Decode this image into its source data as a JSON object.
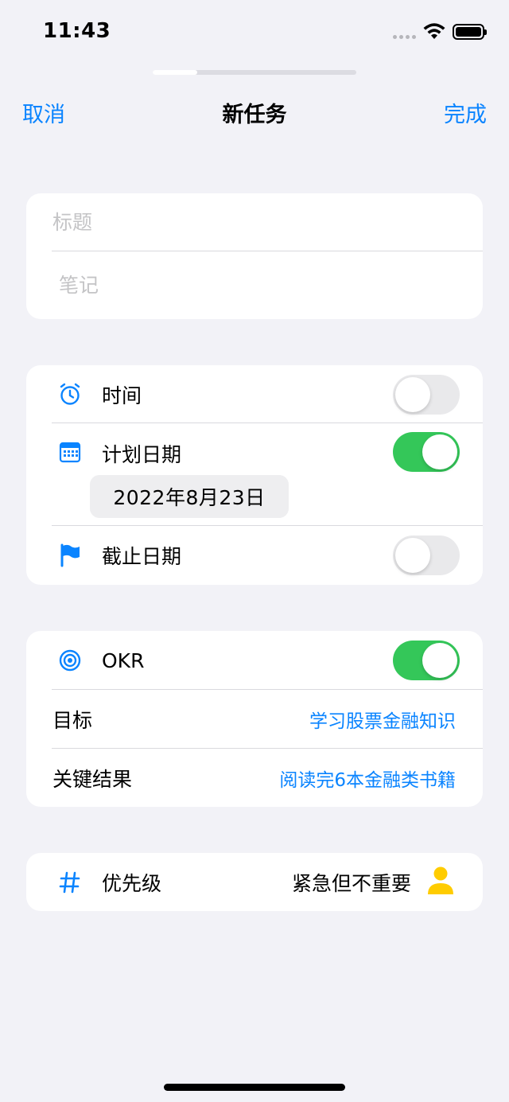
{
  "status_bar": {
    "time": "11:43"
  },
  "nav": {
    "cancel": "取消",
    "title": "新任务",
    "done": "完成"
  },
  "text_fields": {
    "title_placeholder": "标题",
    "notes_placeholder": "笔记"
  },
  "schedule": {
    "time_label": "时间",
    "time_enabled": false,
    "plan_date_label": "计划日期",
    "plan_date_enabled": true,
    "plan_date_value": "2022年8月23日",
    "deadline_label": "截止日期",
    "deadline_enabled": false
  },
  "okr": {
    "label": "OKR",
    "enabled": true,
    "goal_label": "目标",
    "goal_value": "学习股票金融知识",
    "key_result_label": "关键结果",
    "key_result_value": "阅读完6本金融类书籍"
  },
  "priority": {
    "label": "优先级",
    "value": "紧急但不重要"
  },
  "colors": {
    "accent": "#0a84ff",
    "toggle_on": "#34c759",
    "toggle_off": "#e9e9eb",
    "background": "#f2f2f7",
    "person_icon": "#ffcc00"
  },
  "icons": {
    "time": "alarm-clock-icon",
    "plan_date": "calendar-icon",
    "deadline": "flag-icon",
    "okr": "target-icon",
    "priority": "hashtag-icon",
    "priority_badge": "person-icon"
  }
}
